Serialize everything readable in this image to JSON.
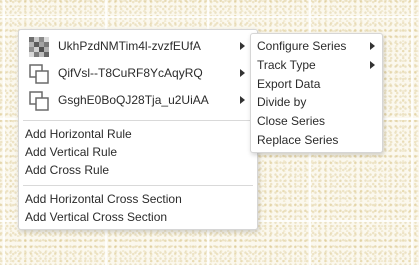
{
  "context_menu": {
    "series": [
      {
        "label": "UkhPzdNMTim4l-zvzfEUfA",
        "icon": "checker-series-icon"
      },
      {
        "label": "QifVsl--T8CuRF8YcAqyRQ",
        "icon": "overlay-series-icon"
      },
      {
        "label": "GsghE0BoQJ28Tja_u2UiAA",
        "icon": "overlay-series-icon"
      }
    ],
    "rules": [
      "Add Horizontal Rule",
      "Add Vertical Rule",
      "Add Cross Rule"
    ],
    "cross_sections": [
      "Add Horizontal Cross Section",
      "Add Vertical Cross Section"
    ]
  },
  "series_submenu": {
    "items": [
      {
        "label": "Configure Series",
        "has_submenu": true
      },
      {
        "label": "Track Type",
        "has_submenu": true
      },
      {
        "label": "Export Data",
        "has_submenu": false
      },
      {
        "label": "Divide by",
        "has_submenu": false
      },
      {
        "label": "Close Series",
        "has_submenu": false
      },
      {
        "label": "Replace Series",
        "has_submenu": false
      }
    ]
  },
  "colors": {
    "background": "#fbf8ee",
    "menu_background": "#ffffff",
    "menu_border": "#d6d6d6",
    "text": "#2b2b2b"
  }
}
